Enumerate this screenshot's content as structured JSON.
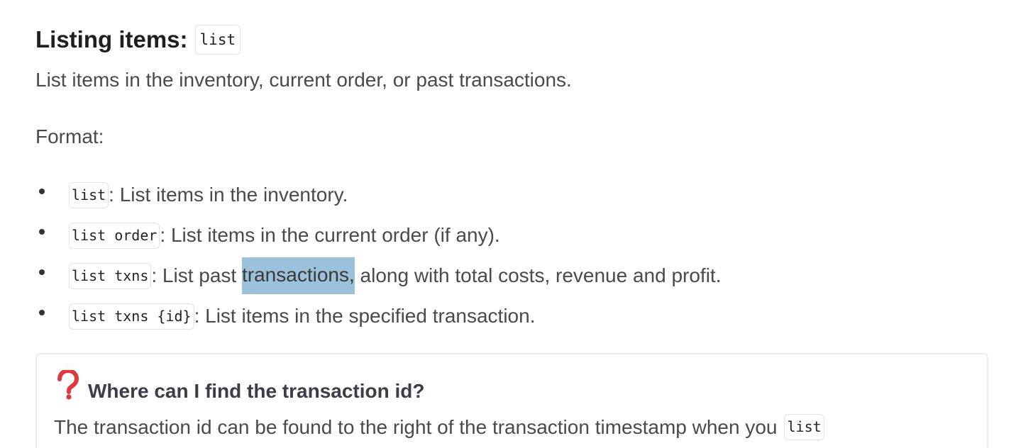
{
  "heading": {
    "text": "Listing items:",
    "code": "list"
  },
  "intro": "List items in the inventory, current order, or past transactions.",
  "format_label": "Format:",
  "bullets": [
    {
      "code": "list",
      "text": ": List items in the inventory."
    },
    {
      "code": "list order",
      "text": ": List items in the current order (if any)."
    },
    {
      "code": "list txns",
      "text_before": ": List past ",
      "highlight": "transactions,",
      "text_after": " along with total costs, revenue and profit."
    },
    {
      "code": "list txns {id}",
      "text": ": List items in the specified transaction."
    }
  ],
  "callout": {
    "icon": "question-mark-icon",
    "icon_color": "#e0383e",
    "title": "Where can I find the transaction id?",
    "body_text": "The transaction id can be found to the right of the transaction timestamp when you",
    "body_code": "list"
  },
  "colors": {
    "selection_highlight": "#9cc1da",
    "body_text": "#4a4a4a",
    "heading_text": "#1f1f1f"
  }
}
